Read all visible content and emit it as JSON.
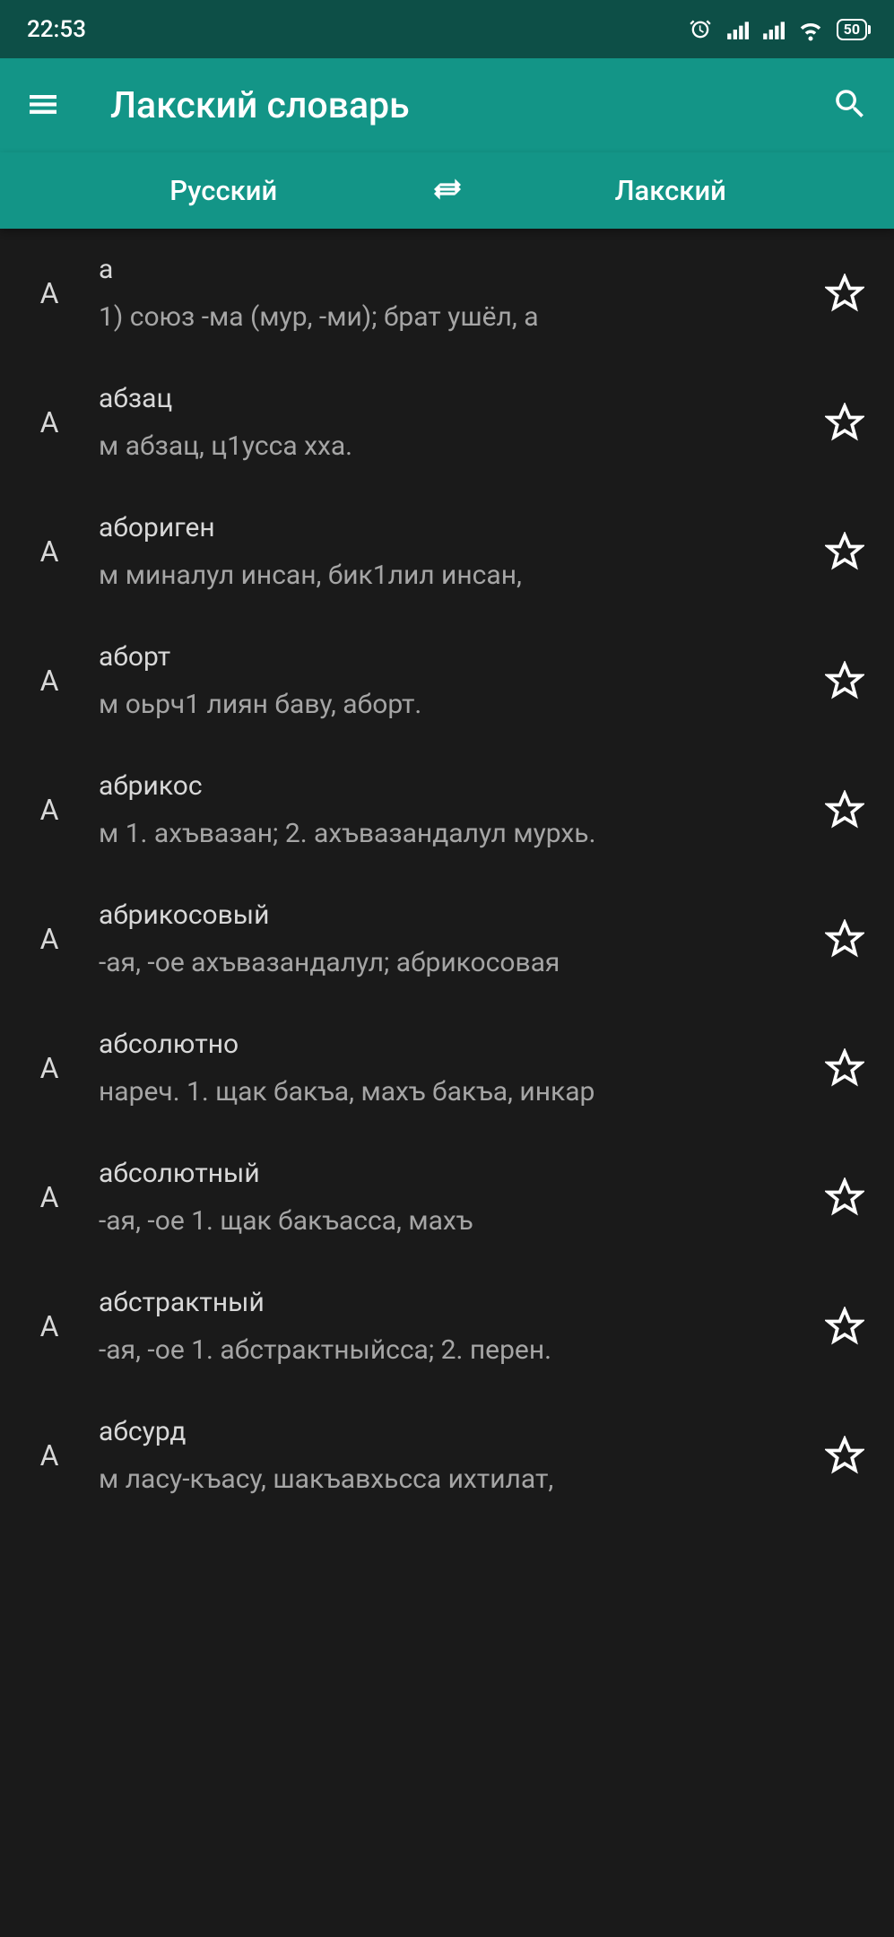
{
  "status": {
    "time": "22:53",
    "battery": "50"
  },
  "header": {
    "title": "Лакский словарь"
  },
  "langBar": {
    "from": "Русский",
    "to": "Лакский"
  },
  "entries": [
    {
      "letter": "А",
      "word": "а",
      "def": "1) союз -ма (мур, -ми); брат ушёл, а"
    },
    {
      "letter": "А",
      "word": "абзац",
      "def": "м абзац, ц1усса хха."
    },
    {
      "letter": "А",
      "word": "абориген",
      "def": "м миналул инсан, бик1лил инсан,"
    },
    {
      "letter": "А",
      "word": "аборт",
      "def": "м оьрч1 лиян баву, аборт."
    },
    {
      "letter": "А",
      "word": "абрикос",
      "def": "м 1. ахъвазан; 2. ахъвазандалул мурхь."
    },
    {
      "letter": "А",
      "word": "абрикосовый",
      "def": "-ая, -ое ахъвазандалул; абрикосовая"
    },
    {
      "letter": "А",
      "word": "абсолютно",
      "def": "нареч. 1. щак бакъа, махъ бакъа, инкар"
    },
    {
      "letter": "А",
      "word": "абсолютный",
      "def": "-ая, -ое 1. щак бакъасса, махъ"
    },
    {
      "letter": "А",
      "word": "абстрактный",
      "def": "-ая, -ое 1. абстрактныйсса; 2. перен."
    },
    {
      "letter": "А",
      "word": "абсурд",
      "def": "м ласу-къасу, шакъавхьсса ихтилат,"
    }
  ]
}
